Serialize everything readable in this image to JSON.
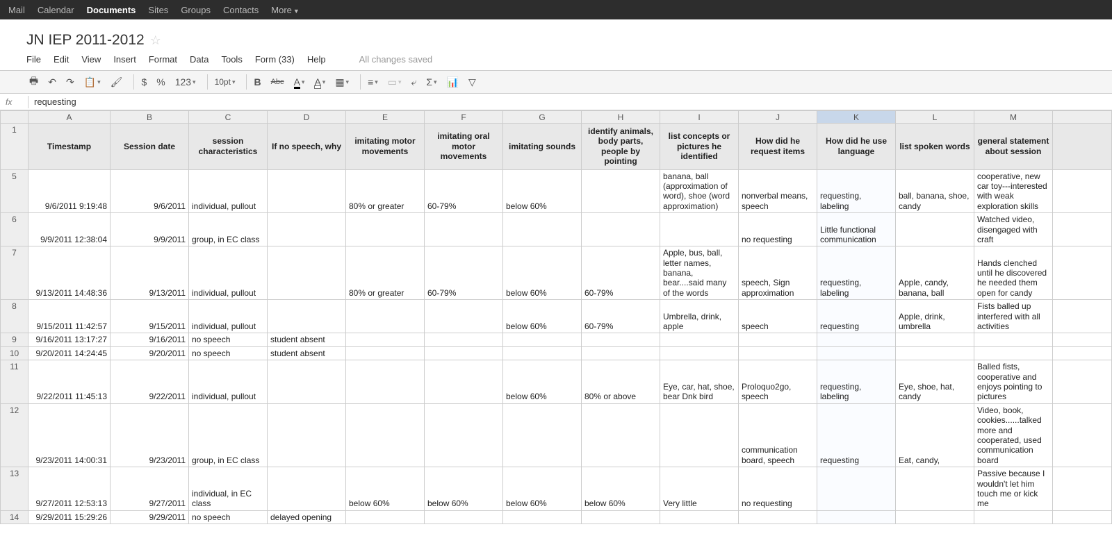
{
  "topnav": {
    "items": [
      "Mail",
      "Calendar",
      "Documents",
      "Sites",
      "Groups",
      "Contacts",
      "More"
    ],
    "active_index": 2
  },
  "doc": {
    "title": "JN IEP 2011-2012"
  },
  "menubar": {
    "items": [
      "File",
      "Edit",
      "View",
      "Insert",
      "Format",
      "Data",
      "Tools",
      "Form (33)",
      "Help"
    ],
    "status": "All changes saved"
  },
  "toolbar": {
    "fontsize": "10pt"
  },
  "formulabar": {
    "fx": "fx",
    "value": "requesting"
  },
  "columns": [
    "A",
    "B",
    "C",
    "D",
    "E",
    "F",
    "G",
    "H",
    "I",
    "J",
    "K",
    "L",
    "M"
  ],
  "selected_col_index": 10,
  "headers": [
    "Timestamp",
    "Session date",
    "session characteristics",
    "If no speech, why",
    "imitating motor movements",
    "imitating oral motor movements",
    "imitating sounds",
    "identify animals, body parts, people by pointing",
    "list concepts or pictures he identified",
    "How did he request items",
    "How did he use language",
    "list spoken words",
    "general statement about session"
  ],
  "rows": [
    {
      "n": "5",
      "c": [
        "9/6/2011 9:19:48",
        "9/6/2011",
        "individual, pullout",
        "",
        "80% or greater",
        "60-79%",
        "below 60%",
        "",
        "banana, ball (approximation of word), shoe (word approximation)",
        "nonverbal means, speech",
        "requesting, labeling",
        "ball, banana, shoe, candy",
        "cooperative, new car toy---interested with weak exploration skills"
      ]
    },
    {
      "n": "6",
      "c": [
        "9/9/2011 12:38:04",
        "9/9/2011",
        "group, in EC class",
        "",
        "",
        "",
        "",
        "",
        "",
        "no requesting",
        "Little functional communication",
        "",
        "Watched video, disengaged with craft"
      ]
    },
    {
      "n": "7",
      "c": [
        "9/13/2011 14:48:36",
        "9/13/2011",
        "individual, pullout",
        "",
        "80% or greater",
        "60-79%",
        "below 60%",
        "60-79%",
        "Apple, bus, ball, letter names, banana, bear....said many of the words",
        "speech, Sign approximation",
        "requesting, labeling",
        "Apple, candy, banana, ball",
        "Hands clenched until he discovered he needed them open for candy"
      ]
    },
    {
      "n": "8",
      "c": [
        "9/15/2011 11:42:57",
        "9/15/2011",
        "individual, pullout",
        "",
        "",
        "",
        "below 60%",
        "60-79%",
        "Umbrella, drink, apple",
        "speech",
        "requesting",
        "Apple, drink, umbrella",
        "Fists balled up interfered with all activities"
      ]
    },
    {
      "n": "9",
      "c": [
        "9/16/2011 13:17:27",
        "9/16/2011",
        "no speech",
        "student absent",
        "",
        "",
        "",
        "",
        "",
        "",
        "",
        "",
        ""
      ]
    },
    {
      "n": "10",
      "c": [
        "9/20/2011 14:24:45",
        "9/20/2011",
        "no speech",
        "student absent",
        "",
        "",
        "",
        "",
        "",
        "",
        "",
        "",
        ""
      ]
    },
    {
      "n": "11",
      "c": [
        "9/22/2011 11:45:13",
        "9/22/2011",
        "individual, pullout",
        "",
        "",
        "",
        "below 60%",
        "80% or above",
        "Eye, car, hat, shoe, bear Dnk bird",
        "Proloquo2go, speech",
        "requesting, labeling",
        "Eye, shoe, hat, candy",
        "Balled fists, cooperative and enjoys pointing to pictures"
      ]
    },
    {
      "n": "12",
      "c": [
        "9/23/2011 14:00:31",
        "9/23/2011",
        "group, in EC class",
        "",
        "",
        "",
        "",
        "",
        "",
        "communication board, speech",
        "requesting",
        "Eat, candy,",
        "Video, book, cookies......talked more and cooperated, used communication board"
      ]
    },
    {
      "n": "13",
      "c": [
        "9/27/2011 12:53:13",
        "9/27/2011",
        "individual, in EC class",
        "",
        "below 60%",
        "below 60%",
        "below 60%",
        "below 60%",
        "Very little",
        "no requesting",
        "",
        "",
        "Passive because I wouldn't let him touch me or kick me"
      ]
    },
    {
      "n": "14",
      "c": [
        "9/29/2011 15:29:26",
        "9/29/2011",
        "no speech",
        "delayed opening",
        "",
        "",
        "",
        "",
        "",
        "",
        "",
        "",
        ""
      ]
    }
  ]
}
